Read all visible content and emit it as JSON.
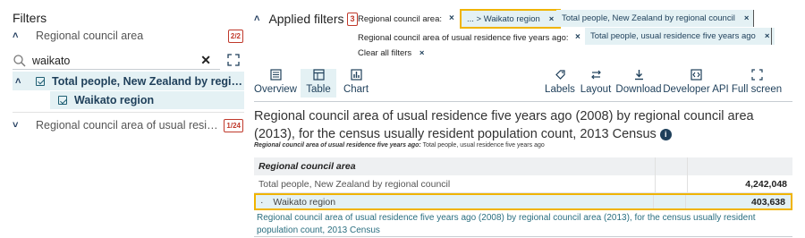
{
  "filters_panel": {
    "title": "Filters",
    "sections": [
      {
        "label": "Regional council area",
        "count": "2/2",
        "expanded": true
      },
      {
        "label": "Regional council area of usual residen...",
        "count": "1/24",
        "expanded": false
      }
    ],
    "search": {
      "value": "waikato",
      "icon": "search-icon",
      "clear_icon": "close-icon"
    },
    "tree": {
      "parent_label": "Total people, New Zealand by regional co...",
      "child_label": "Waikato region"
    }
  },
  "applied_filters": {
    "title": "Applied filters",
    "count": "3",
    "rows": [
      {
        "label": "Regional council area:",
        "chips": [
          "... > Waikato region",
          "Total people, New Zealand by regional council"
        ]
      },
      {
        "label": "Regional council area of usual residence five years ago:",
        "chips": [
          "Total people, usual residence five years ago"
        ]
      }
    ],
    "clear_all": "Clear all filters",
    "remove_glyph": "×"
  },
  "toolbar": {
    "left": [
      {
        "label": "Overview",
        "icon": "overview-icon"
      },
      {
        "label": "Table",
        "icon": "table-icon",
        "active": true
      },
      {
        "label": "Chart",
        "icon": "chart-icon"
      }
    ],
    "right": [
      {
        "label": "Labels",
        "icon": "labels-icon"
      },
      {
        "label": "Layout",
        "icon": "layout-icon"
      },
      {
        "label": "Download",
        "icon": "download-icon"
      },
      {
        "label": "Developer API",
        "icon": "api-icon"
      },
      {
        "label": "Full screen",
        "icon": "fullscreen-icon"
      }
    ]
  },
  "content": {
    "title": "Regional council area of usual residence five years ago (2008) by regional council area (2013), for the census usually resident population count, 2013 Census",
    "subtitle_label": "Regional council area of usual residence five years ago:",
    "subtitle_value": "Total people, usual residence five years ago",
    "table": {
      "header": "Regional council area",
      "rows": [
        {
          "label": "Total people, New Zealand by regional council",
          "value": "4,242,048"
        },
        {
          "label": "Waikato region",
          "bullet": "·",
          "value": "403,638",
          "highlighted": true
        }
      ]
    },
    "footnote": "Regional council area of usual residence five years ago (2008) by regional council area (2013), for the census usually resident population count, 2013 Census"
  },
  "colors": {
    "accent": "#1e3f5a",
    "highlight": "#f0b400",
    "selection_bg": "#e4f1f4",
    "badge": "#c0392b"
  }
}
